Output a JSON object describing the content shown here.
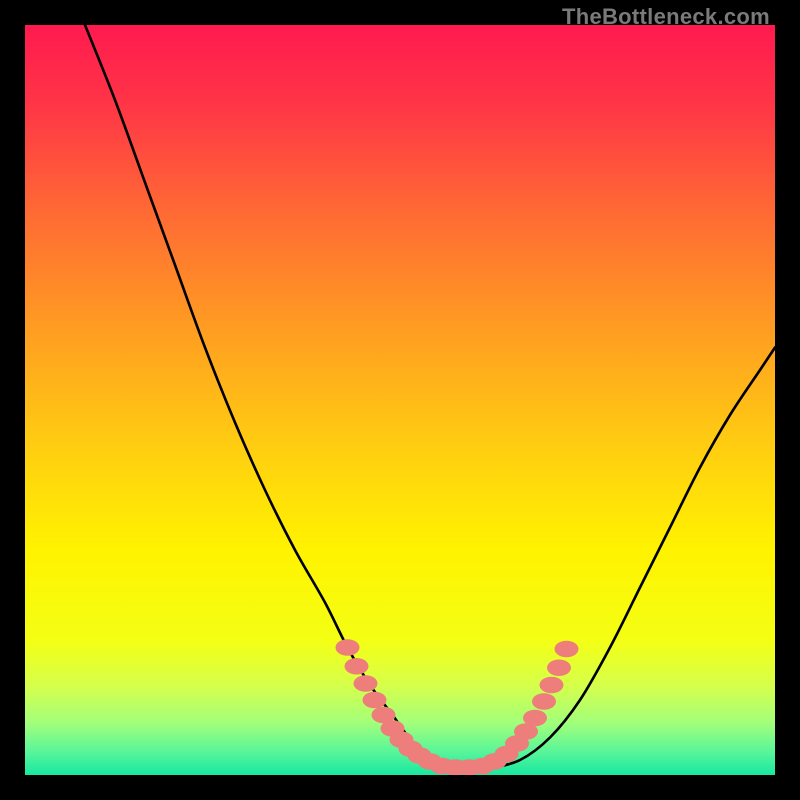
{
  "watermark": "TheBottleneck.com",
  "colors": {
    "frame": "#000000",
    "curve": "#000000",
    "dot_fill": "#ed7e7c",
    "dot_stroke": "#ed7e7c"
  },
  "chart_data": {
    "type": "line",
    "title": "",
    "xlabel": "",
    "ylabel": "",
    "xlim": [
      0,
      100
    ],
    "ylim": [
      0,
      100
    ],
    "gradient_stops": [
      {
        "offset": 0.0,
        "color": "#ff1a4f"
      },
      {
        "offset": 0.1,
        "color": "#ff3347"
      },
      {
        "offset": 0.25,
        "color": "#ff6a34"
      },
      {
        "offset": 0.4,
        "color": "#ff9b22"
      },
      {
        "offset": 0.55,
        "color": "#ffca12"
      },
      {
        "offset": 0.7,
        "color": "#fff300"
      },
      {
        "offset": 0.82,
        "color": "#f4ff14"
      },
      {
        "offset": 0.88,
        "color": "#d6ff4a"
      },
      {
        "offset": 0.93,
        "color": "#a3ff7a"
      },
      {
        "offset": 0.97,
        "color": "#56f59a"
      },
      {
        "offset": 1.0,
        "color": "#18e8a0"
      }
    ],
    "series": [
      {
        "name": "bottleneck-curve",
        "x": [
          8,
          12,
          16,
          20,
          24,
          28,
          32,
          36,
          40,
          43,
          46,
          49,
          52,
          55,
          58,
          62,
          66,
          70,
          74,
          78,
          82,
          86,
          90,
          94,
          98,
          100
        ],
        "y": [
          100,
          90,
          79,
          68,
          57,
          47,
          38,
          30,
          23,
          17,
          12,
          8,
          4,
          2,
          1,
          1,
          2,
          5,
          10,
          17,
          25,
          33,
          41,
          48,
          54,
          57
        ]
      }
    ],
    "scatter": {
      "name": "highlight-dots",
      "points": [
        {
          "x": 43.0,
          "y": 17.0
        },
        {
          "x": 44.2,
          "y": 14.5
        },
        {
          "x": 45.4,
          "y": 12.2
        },
        {
          "x": 46.6,
          "y": 10.0
        },
        {
          "x": 47.8,
          "y": 8.0
        },
        {
          "x": 49.0,
          "y": 6.2
        },
        {
          "x": 50.2,
          "y": 4.7
        },
        {
          "x": 51.4,
          "y": 3.5
        },
        {
          "x": 52.6,
          "y": 2.6
        },
        {
          "x": 54.0,
          "y": 1.8
        },
        {
          "x": 55.6,
          "y": 1.2
        },
        {
          "x": 57.4,
          "y": 1.0
        },
        {
          "x": 59.2,
          "y": 1.0
        },
        {
          "x": 61.0,
          "y": 1.2
        },
        {
          "x": 62.6,
          "y": 1.8
        },
        {
          "x": 64.2,
          "y": 2.8
        },
        {
          "x": 65.6,
          "y": 4.2
        },
        {
          "x": 66.8,
          "y": 5.8
        },
        {
          "x": 68.0,
          "y": 7.6
        },
        {
          "x": 69.2,
          "y": 9.8
        },
        {
          "x": 70.2,
          "y": 12.0
        },
        {
          "x": 71.2,
          "y": 14.3
        },
        {
          "x": 72.2,
          "y": 16.8
        }
      ]
    }
  }
}
